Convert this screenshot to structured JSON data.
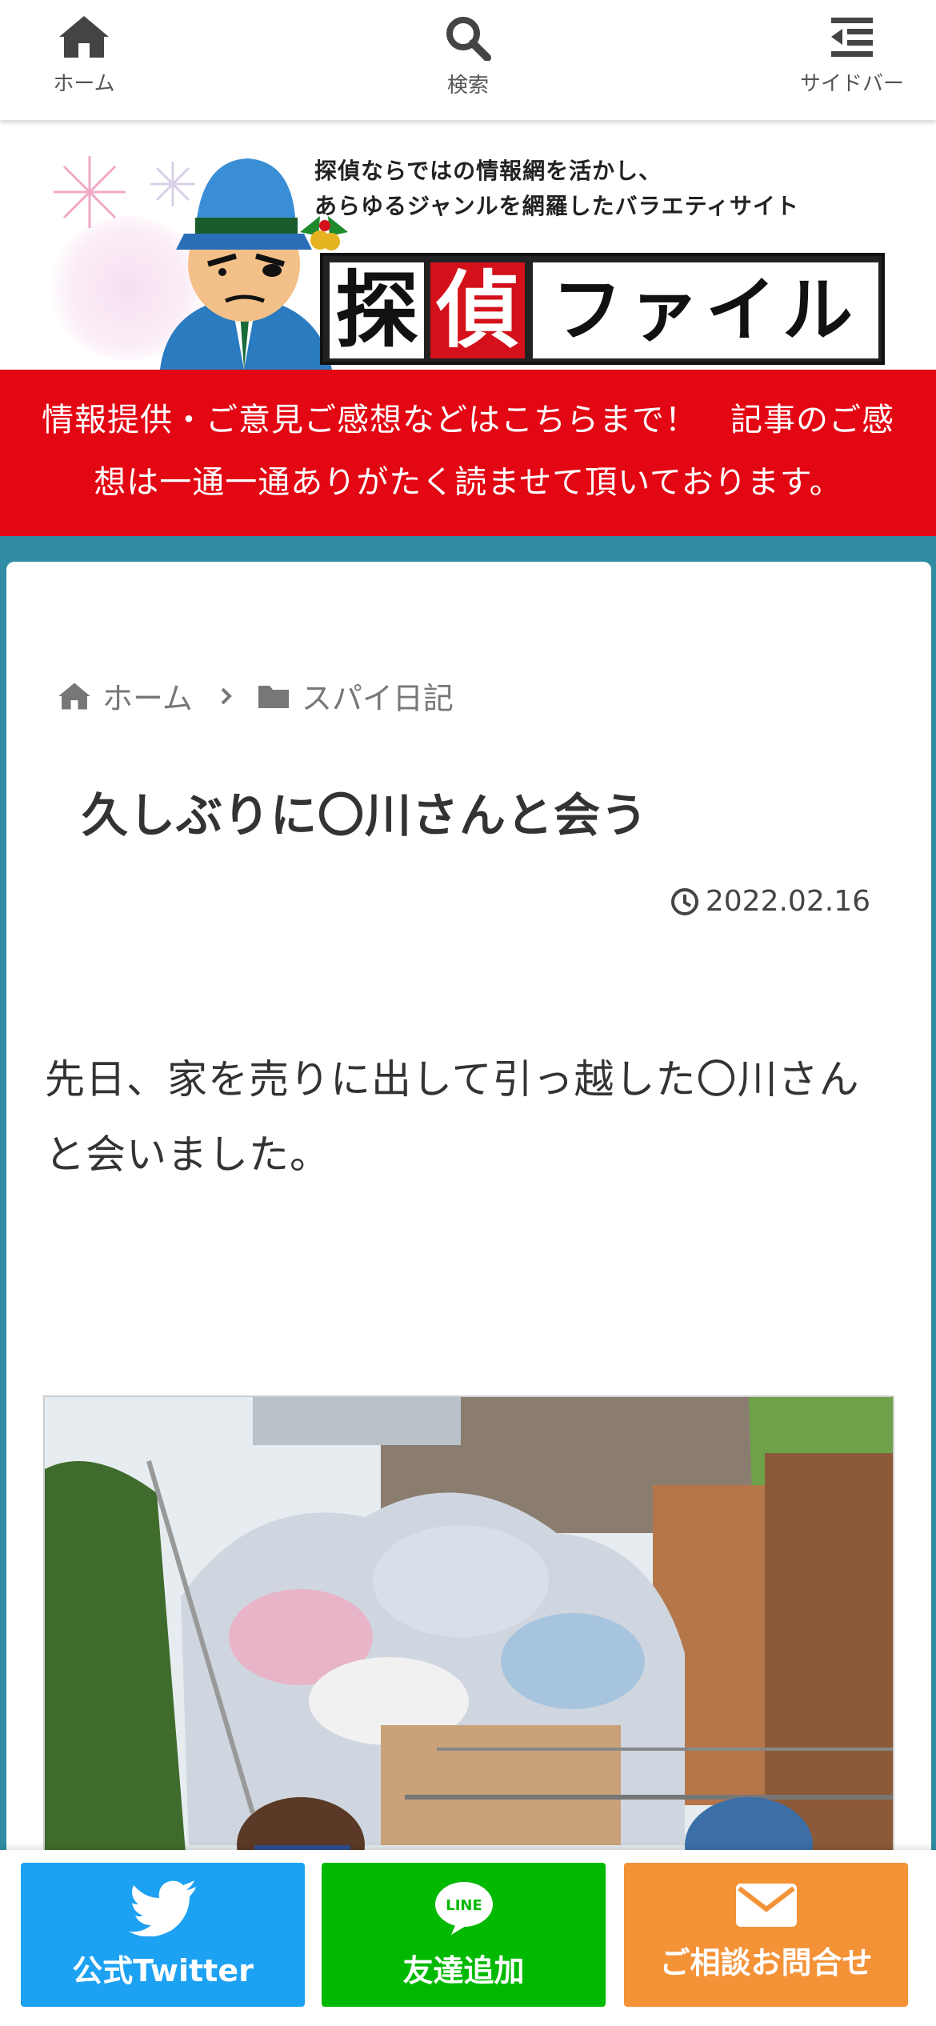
{
  "nav": {
    "home_label": "ホーム",
    "search_label": "検索",
    "sidebar_label": "サイドバー"
  },
  "header": {
    "tagline_line1": "探偵ならではの情報網を活かし、",
    "tagline_line2": "あらゆるジャンルを網羅したバラエティサイト",
    "logo_char1": "探",
    "logo_char2": "偵",
    "logo_rest": "ファイル"
  },
  "notice": {
    "text": "情報提供・ご意見ご感想などはこちらまで！　記事のご感想は一通一通ありがたく読ませて頂いております。"
  },
  "breadcrumb": {
    "home": "ホーム",
    "category": "スパイ日記"
  },
  "article": {
    "title": "久しぶりに〇川さんと会う",
    "date": "2022.02.16",
    "body": "先日、家を売りに出して引っ越した〇川さんと会いました。"
  },
  "cta": {
    "twitter": "公式Twitter",
    "line": "友達追加",
    "line_icon_text": "LINE",
    "contact": "ご相談お問合せ"
  },
  "colors": {
    "background": "#2f8ca3",
    "notice_red": "#e30613",
    "twitter_blue": "#1da1f2",
    "line_green": "#00b900",
    "contact_orange": "#f39237"
  }
}
